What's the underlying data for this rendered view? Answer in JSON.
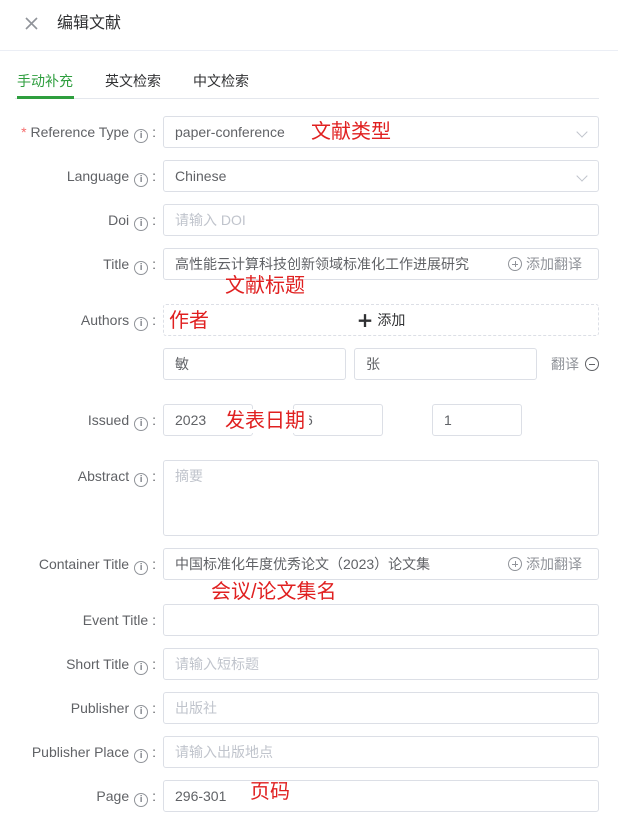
{
  "header": {
    "title": "编辑文献"
  },
  "tabs": [
    {
      "label": "手动补充",
      "active": true
    },
    {
      "label": "英文检索",
      "active": false
    },
    {
      "label": "中文检索",
      "active": false
    }
  ],
  "fields": {
    "reference_type": {
      "label": "Reference Type",
      "value": "paper-conference",
      "required": true
    },
    "language": {
      "label": "Language",
      "value": "Chinese"
    },
    "doi": {
      "label": "Doi",
      "placeholder": "请输入 DOI"
    },
    "title": {
      "label": "Title",
      "value": "高性能云计算科技创新领域标准化工作进展研究",
      "translate_label": "添加翻译"
    },
    "authors": {
      "label": "Authors",
      "add_label": "添加",
      "list": [
        {
          "given": "敏",
          "family": "张",
          "translate_label": "翻译"
        }
      ]
    },
    "issued": {
      "label": "Issued",
      "year": "2023",
      "month": "6",
      "day": "1"
    },
    "abstract": {
      "label": "Abstract",
      "placeholder": "摘要"
    },
    "container_title": {
      "label": "Container Title",
      "value": "中国标准化年度优秀论文（2023）论文集",
      "translate_label": "添加翻译"
    },
    "event_title": {
      "label": "Event Title",
      "value": ""
    },
    "short_title": {
      "label": "Short Title",
      "placeholder": "请输入短标题"
    },
    "publisher": {
      "label": "Publisher",
      "placeholder": "出版社"
    },
    "publisher_place": {
      "label": "Publisher Place",
      "placeholder": "请输入出版地点"
    },
    "page": {
      "label": "Page",
      "value": "296-301"
    }
  },
  "annotations": {
    "reference_type": "文献类型",
    "title": "文献标题",
    "authors": "作者",
    "issued": "发表日期",
    "container_title": "会议/论文集名",
    "page": "页码"
  },
  "colors": {
    "accent": "#2e9e3e",
    "annotation": "#e02020",
    "required": "#f56c6c"
  },
  "icons": {
    "close": "close-icon",
    "info": "info-icon",
    "dropdown": "chevron-down-icon",
    "add": "plus-icon",
    "remove": "minus-circle-icon"
  }
}
